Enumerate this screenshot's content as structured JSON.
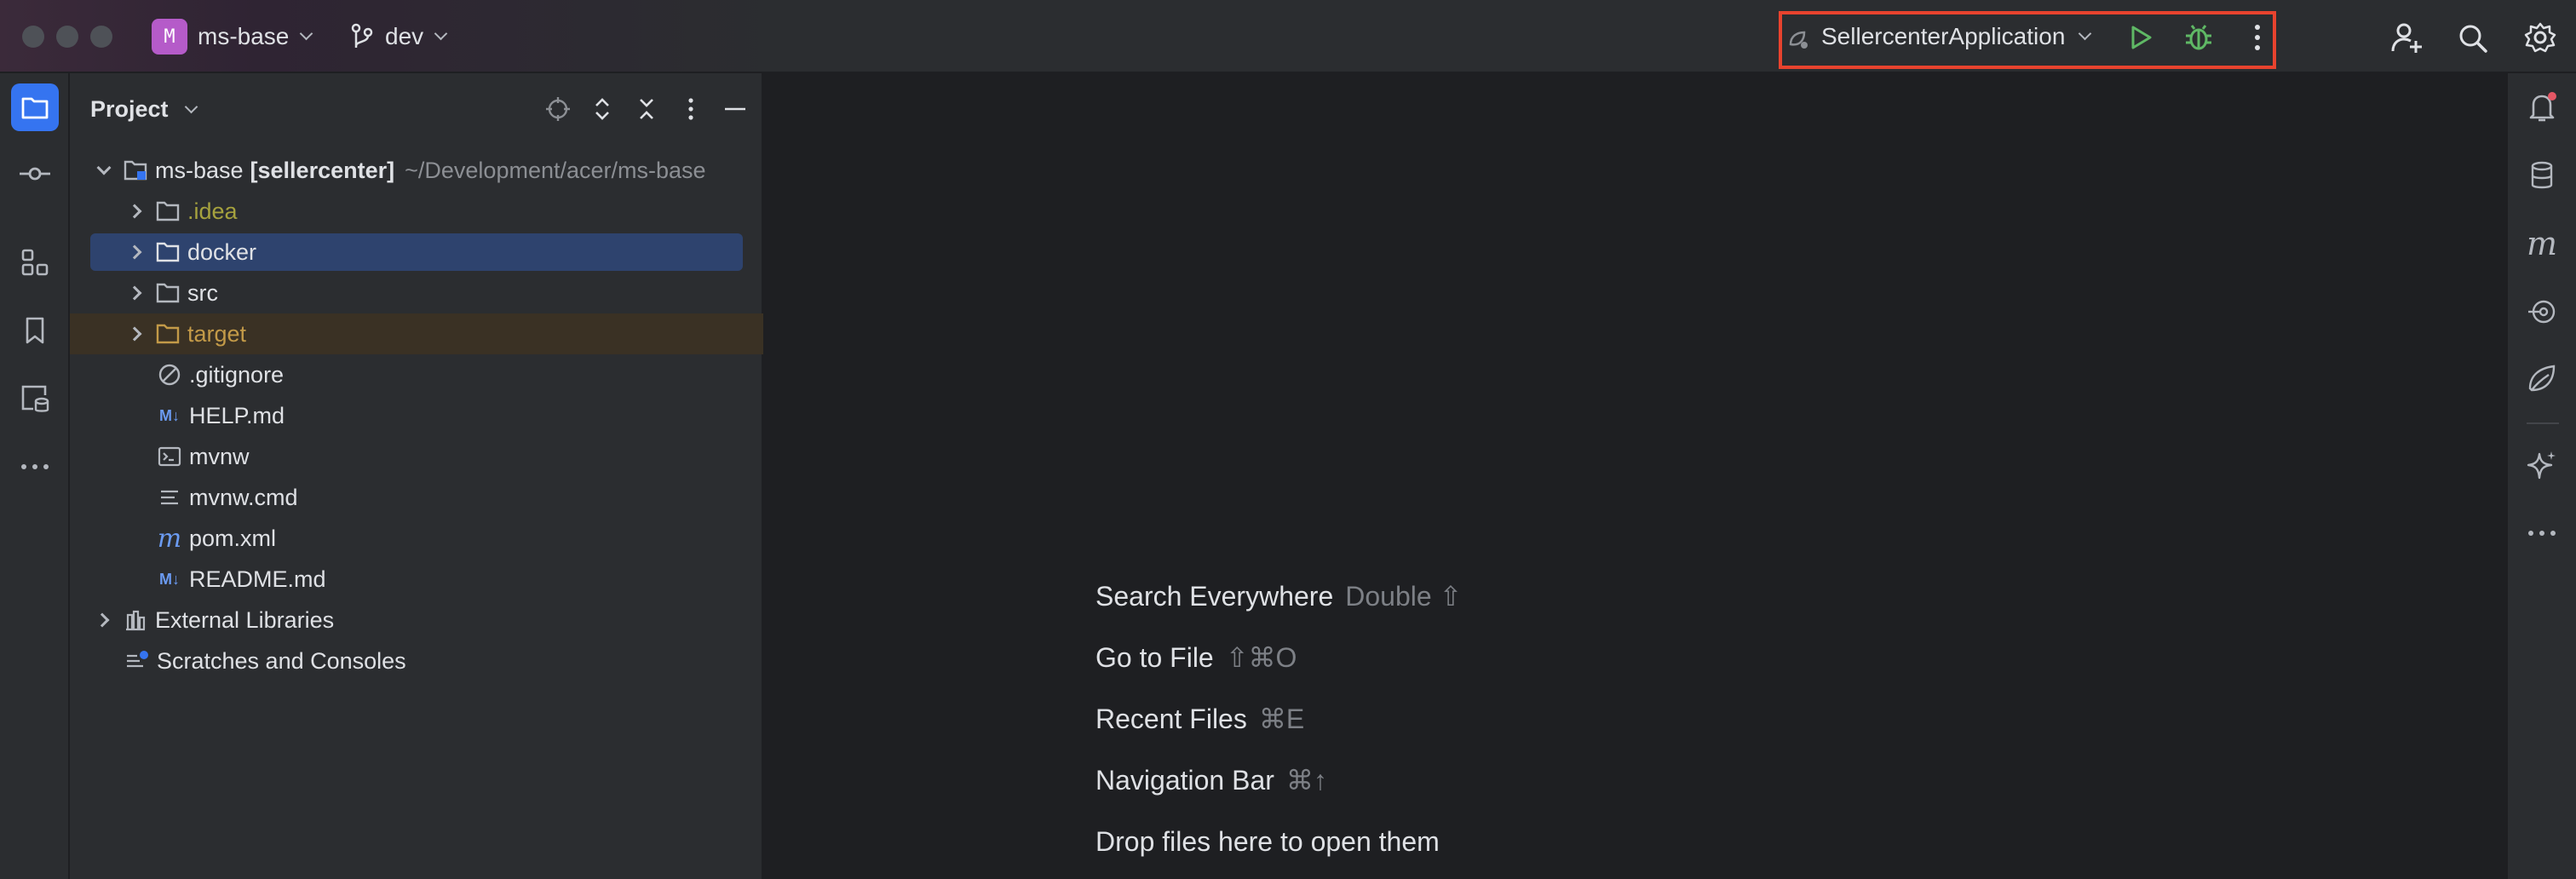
{
  "titlebar": {
    "project_badge": "M",
    "project_name": "ms-base",
    "branch": "dev",
    "run_config": "SellercenterApplication",
    "icons": [
      "window-close-dot",
      "window-minimize-dot",
      "window-zoom-dot",
      "branch-icon",
      "run-icon",
      "debug-icon",
      "more-vertical-icon",
      "add-user-icon",
      "search-icon",
      "settings-gear-icon"
    ]
  },
  "left_strip": {
    "items": [
      "project-folder-icon",
      "commit-icon",
      "structure-icon",
      "bookmarks-icon",
      "services-icon",
      "more-tools-icon"
    ]
  },
  "right_strip": {
    "items": [
      "notifications-icon",
      "database-icon",
      "maven-icon",
      "endpoints-icon",
      "spring-icon",
      "ai-assistant-icon",
      "more-tools-icon"
    ]
  },
  "project_panel": {
    "title": "Project",
    "tree": [
      {
        "label": "ms-base",
        "module": "[sellercenter]",
        "path": "~/Development/acer/ms-base",
        "kind": "module",
        "depth": 0,
        "expanded": true
      },
      {
        "label": ".idea",
        "kind": "folder",
        "depth": 1,
        "color": "#a6a23e"
      },
      {
        "label": "docker",
        "kind": "folder",
        "depth": 1,
        "selected": true
      },
      {
        "label": "src",
        "kind": "folder",
        "depth": 1
      },
      {
        "label": "target",
        "kind": "folder",
        "depth": 1,
        "color": "#c39a48",
        "excluded": true
      },
      {
        "label": ".gitignore",
        "kind": "ignore-file",
        "depth": 1
      },
      {
        "label": "HELP.md",
        "kind": "markdown-file",
        "depth": 1
      },
      {
        "label": "mvnw",
        "kind": "shell-file",
        "depth": 1
      },
      {
        "label": "mvnw.cmd",
        "kind": "text-file",
        "depth": 1
      },
      {
        "label": "pom.xml",
        "kind": "maven-file",
        "depth": 1
      },
      {
        "label": "README.md",
        "kind": "markdown-file",
        "depth": 1
      },
      {
        "label": "External Libraries",
        "kind": "libraries",
        "depth": 0
      },
      {
        "label": "Scratches and Consoles",
        "kind": "scratches",
        "depth": 0
      }
    ]
  },
  "editor_hints": [
    {
      "label": "Search Everywhere",
      "shortcut": "Double ⇧"
    },
    {
      "label": "Go to File",
      "shortcut": "⇧⌘O"
    },
    {
      "label": "Recent Files",
      "shortcut": "⌘E"
    },
    {
      "label": "Navigation Bar",
      "shortcut": "⌘↑"
    },
    {
      "label": "Drop files here to open them",
      "shortcut": ""
    }
  ],
  "colors": {
    "accent": "#3574f0",
    "annotation": "#e8432e",
    "run_green": "#5fb865"
  }
}
